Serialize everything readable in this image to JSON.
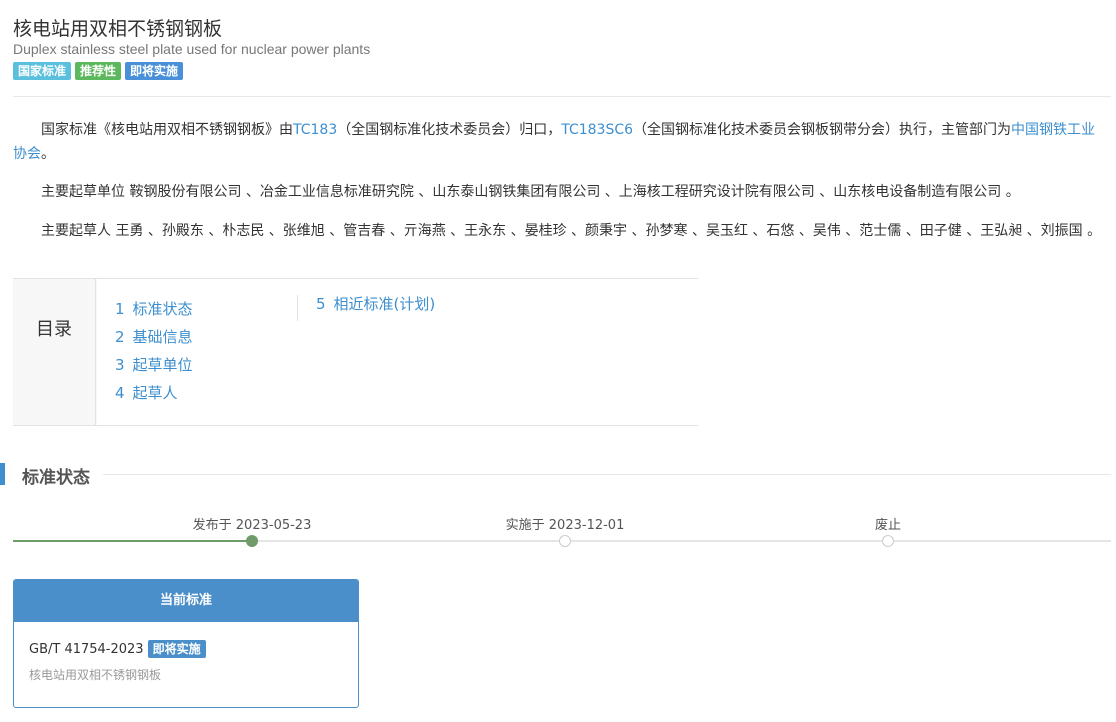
{
  "header": {
    "title": "核电站用双相不锈钢钢板",
    "subtitle": "Duplex stainless steel plate used for nuclear power plants",
    "badges": [
      {
        "label": "国家标准",
        "color": "#5bc0de"
      },
      {
        "label": "推荐性",
        "color": "#5cb85c"
      },
      {
        "label": "即将实施",
        "color": "#4a90d9"
      }
    ]
  },
  "intro": {
    "p1_a": "国家标准《核电站用双相不锈钢钢板》由",
    "p1_link1": "TC183",
    "p1_b": "（全国钢标准化技术委员会）归口，",
    "p1_link2": "TC183SC6",
    "p1_c": "（全国钢标准化技术委员会钢板钢带分会）执行，主管部门为",
    "p1_link3": "中国钢铁工业协会",
    "p1_d": "。",
    "p2": "主要起草单位 鞍钢股份有限公司 、冶金工业信息标准研究院 、山东泰山钢铁集团有限公司 、上海核工程研究设计院有限公司 、山东核电设备制造有限公司 。",
    "p3": "主要起草人 王勇 、孙殿东 、朴志民 、张维旭 、管吉春 、亓海燕 、王永东 、晏桂珍 、颜秉宇 、孙梦寒 、吴玉红 、石悠 、吴伟 、范士儒 、田子健 、王弘昶 、刘振国 。"
  },
  "toc": {
    "label": "目录",
    "items": [
      {
        "num": "1",
        "label": "标准状态"
      },
      {
        "num": "2",
        "label": "基础信息"
      },
      {
        "num": "3",
        "label": "起草单位"
      },
      {
        "num": "4",
        "label": "起草人"
      },
      {
        "num": "5",
        "label": "相近标准(计划)"
      }
    ]
  },
  "status_section": {
    "title": "标准状态",
    "timeline": [
      {
        "label": "发布于 2023-05-23",
        "done": true
      },
      {
        "label": "实施于 2023-12-01",
        "done": false
      },
      {
        "label": "废止",
        "done": false
      }
    ]
  },
  "current_card": {
    "header": "当前标准",
    "code": "GB/T 41754-2023",
    "badge": "即将实施",
    "name": "核电站用双相不锈钢钢板"
  },
  "colors": {
    "link": "#3d8fcf",
    "accent": "#4a8fc9",
    "progress": "#6f9a6a"
  }
}
